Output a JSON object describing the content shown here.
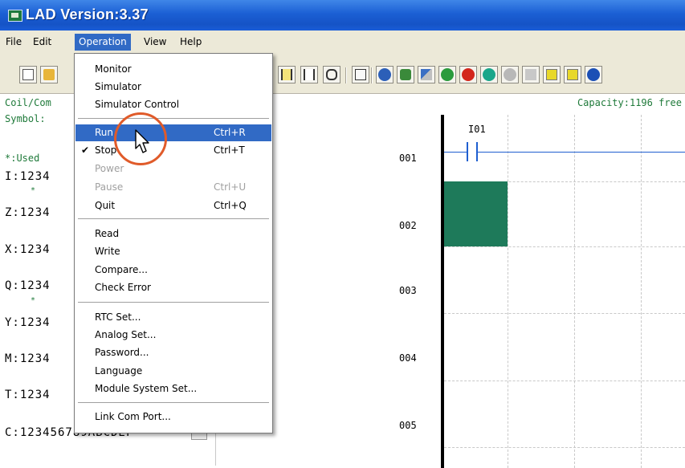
{
  "window": {
    "title": "LAD Version:3.37"
  },
  "menubar": {
    "items": [
      "File",
      "Edit",
      "Operation",
      "View",
      "Help"
    ],
    "active": "Operation"
  },
  "toolbar": {
    "buttons": [
      "new-file-icon",
      "open-folder-icon",
      "contact-no-icon",
      "contact-nc-icon",
      "output-coil-icon",
      "function-block-icon",
      "refresh-icon",
      "transfer-icon",
      "tools-icon",
      "run-icon",
      "stop-icon",
      "quit-icon",
      "circle-icon",
      "monitor-icon",
      "read-icon",
      "write-icon",
      "help-icon"
    ],
    "labels": {
      "run": "Run",
      "stop": "Stop",
      "quit": "Quit"
    },
    "colors": {
      "run": "#2a9b3c",
      "stop": "#d3261c",
      "quit": "#1aa68a",
      "help": "#1b4fb5"
    }
  },
  "left_panel": {
    "coil_label": "Coil/Com",
    "symbol_label": "Symbol:",
    "used_label": "*:Used",
    "rows": [
      {
        "prefix": "I:1234"
      },
      {
        "prefix": "Z:1234"
      },
      {
        "prefix": "X:1234"
      },
      {
        "prefix": "Q:1234"
      },
      {
        "prefix": "Y:1234"
      },
      {
        "prefix": "M:1234"
      },
      {
        "prefix": "T:1234"
      },
      {
        "prefix": "C:123456789ABCDEF"
      }
    ],
    "asterisk": "*",
    "more_button": "..."
  },
  "ladder": {
    "capacity": "Capacity:1196 free",
    "contact_label": "I01",
    "rows": [
      "001",
      "002",
      "003",
      "004",
      "005"
    ]
  },
  "operation_menu": {
    "items": [
      {
        "label": "Monitor",
        "shortcut": "",
        "enabled": true
      },
      {
        "label": "Simulator",
        "shortcut": "",
        "enabled": true
      },
      {
        "label": "Simulator Control",
        "shortcut": "",
        "enabled": true
      },
      {
        "label": "Run",
        "shortcut": "Ctrl+R",
        "enabled": true,
        "highlighted": true
      },
      {
        "label": "Stop",
        "shortcut": "Ctrl+T",
        "enabled": true,
        "checked": true
      },
      {
        "label": "Power",
        "shortcut": "",
        "enabled": false
      },
      {
        "label": "Pause",
        "shortcut": "Ctrl+U",
        "enabled": false
      },
      {
        "label": "Quit",
        "shortcut": "Ctrl+Q",
        "enabled": true
      },
      {
        "label": "Read",
        "shortcut": "",
        "enabled": true
      },
      {
        "label": "Write",
        "shortcut": "",
        "enabled": true
      },
      {
        "label": "Compare...",
        "shortcut": "",
        "enabled": true
      },
      {
        "label": "Check Error",
        "shortcut": "",
        "enabled": true
      },
      {
        "label": "RTC Set...",
        "shortcut": "",
        "enabled": true
      },
      {
        "label": "Analog Set...",
        "shortcut": "",
        "enabled": true
      },
      {
        "label": "Password...",
        "shortcut": "",
        "enabled": true
      },
      {
        "label": "Language",
        "shortcut": "",
        "enabled": true
      },
      {
        "label": "Module System Set...",
        "shortcut": "",
        "enabled": true
      },
      {
        "label": "Link Com Port...",
        "shortcut": "",
        "enabled": true
      }
    ],
    "check_mark": "✔"
  },
  "colors": {
    "titlebar": "#1b5fd4",
    "menu_highlight": "#316ac5",
    "cursor_cell": "#1e7a5a",
    "highlight_ring": "#e05b2a"
  }
}
